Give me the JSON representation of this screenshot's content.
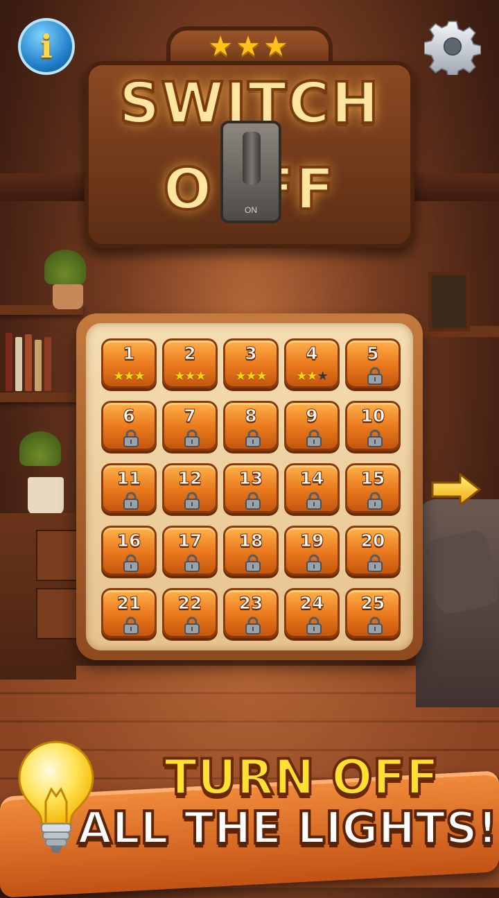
{
  "header": {
    "info_label": "i",
    "settings_icon": "gear-icon"
  },
  "title": {
    "stars": "★★★",
    "line1": "SWITCH",
    "line2": "O  FF",
    "switch_label": "ON"
  },
  "levels": [
    {
      "number": "1",
      "stars": 3,
      "locked": false
    },
    {
      "number": "2",
      "stars": 3,
      "locked": false
    },
    {
      "number": "3",
      "stars": 3,
      "locked": false
    },
    {
      "number": "4",
      "stars": 2,
      "locked": false
    },
    {
      "number": "5",
      "locked": true
    },
    {
      "number": "6",
      "locked": true
    },
    {
      "number": "7",
      "locked": true
    },
    {
      "number": "8",
      "locked": true
    },
    {
      "number": "9",
      "locked": true
    },
    {
      "number": "10",
      "locked": true
    },
    {
      "number": "11",
      "locked": true
    },
    {
      "number": "12",
      "locked": true
    },
    {
      "number": "13",
      "locked": true
    },
    {
      "number": "14",
      "locked": true
    },
    {
      "number": "15",
      "locked": true
    },
    {
      "number": "16",
      "locked": true
    },
    {
      "number": "17",
      "locked": true
    },
    {
      "number": "18",
      "locked": true
    },
    {
      "number": "19",
      "locked": true
    },
    {
      "number": "20",
      "locked": true
    },
    {
      "number": "21",
      "locked": true
    },
    {
      "number": "22",
      "locked": true
    },
    {
      "number": "23",
      "locked": true
    },
    {
      "number": "24",
      "locked": true
    },
    {
      "number": "25",
      "locked": true
    }
  ],
  "navigation": {
    "next_icon": "arrow-right-icon"
  },
  "banner": {
    "line1": "TURN OFF",
    "line2": "ALL THE LIGHTS!",
    "icon": "lightbulb-icon"
  },
  "colors": {
    "star_on": "#ffd21a",
    "star_off": "#3a3530",
    "level_tile": "#e8781c"
  }
}
